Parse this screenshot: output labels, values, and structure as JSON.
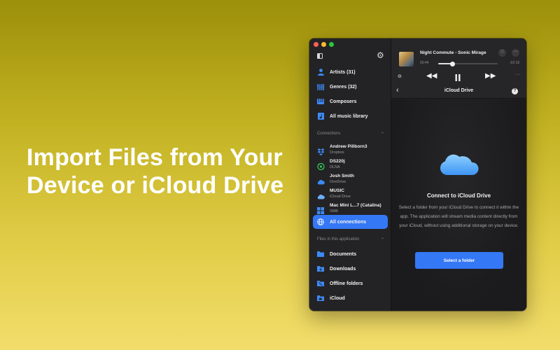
{
  "headline": {
    "line1": "Import Files from Your",
    "line2": "Device or iCloud Drive"
  },
  "sidebar": {
    "library": [
      {
        "label": "Artists (31)",
        "icon": "person-icon"
      },
      {
        "label": "Genres (32)",
        "icon": "sliders-icon"
      },
      {
        "label": "Composers",
        "icon": "piano-icon"
      },
      {
        "label": "All music library",
        "icon": "music-library-icon"
      }
    ],
    "connections_label": "Connections",
    "connections": [
      {
        "name": "Andrew Pillborn3",
        "service": "Dropbox",
        "icon": "dropbox-icon"
      },
      {
        "name": "DS220j",
        "service": "DLNA",
        "icon": "dlna-icon"
      },
      {
        "name": "Josh Smith",
        "service": "OneDrive",
        "icon": "onedrive-icon"
      },
      {
        "name": "MUSIC",
        "service": "iCloud Drive",
        "icon": "icloud-icon"
      },
      {
        "name": "Mac Mini L...7 (Catalina)",
        "service": "SMB",
        "icon": "windows-icon"
      }
    ],
    "all_connections": "All connections",
    "files_label": "Files in this application",
    "files": [
      {
        "label": "Documents",
        "icon": "folder-icon"
      },
      {
        "label": "Downloads",
        "icon": "download-folder-icon"
      },
      {
        "label": "Offline folders",
        "icon": "offline-folder-icon"
      },
      {
        "label": "iCloud",
        "icon": "icloud-folder-icon"
      }
    ]
  },
  "player": {
    "track": "Night Commute - Sonic Mirage",
    "elapsed": "00:44",
    "remaining": "-02:16",
    "progress": 0.24
  },
  "nav": {
    "title": "iCloud Drive"
  },
  "content": {
    "title": "Connect to iCloud Drive",
    "description": "Select a folder from your iCloud Drive to connect it within the app. The application will stream media content directly from your iCloud, without using additional storage on your device.",
    "button": "Select a folder"
  },
  "colors": {
    "accent": "#3478f6",
    "background_top": "#9c8f0a",
    "background_bottom": "#f2dd6c"
  }
}
